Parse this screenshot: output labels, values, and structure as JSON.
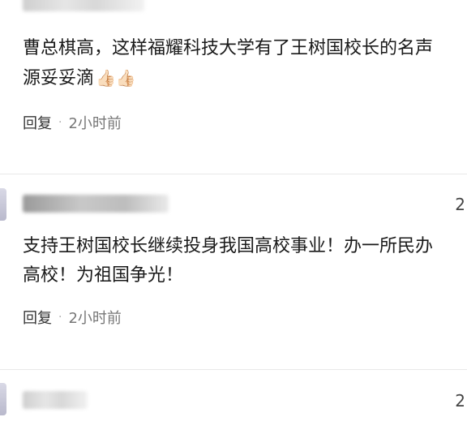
{
  "comments": [
    {
      "lines": [
        "曹总棋高，这样福耀科技大学有了王树国校长的名声",
        "源妥妥滴"
      ],
      "emoji": "👍🏻👍🏻",
      "reply": "回复",
      "sep": "·",
      "time": "2小时前"
    },
    {
      "number": "2",
      "lines": [
        "支持王树国校长继续投身我国高校事业！办一所民办",
        "高校！为祖国争光！"
      ],
      "reply": "回复",
      "sep": "·",
      "time": "2小时前"
    },
    {
      "number": "2"
    }
  ]
}
